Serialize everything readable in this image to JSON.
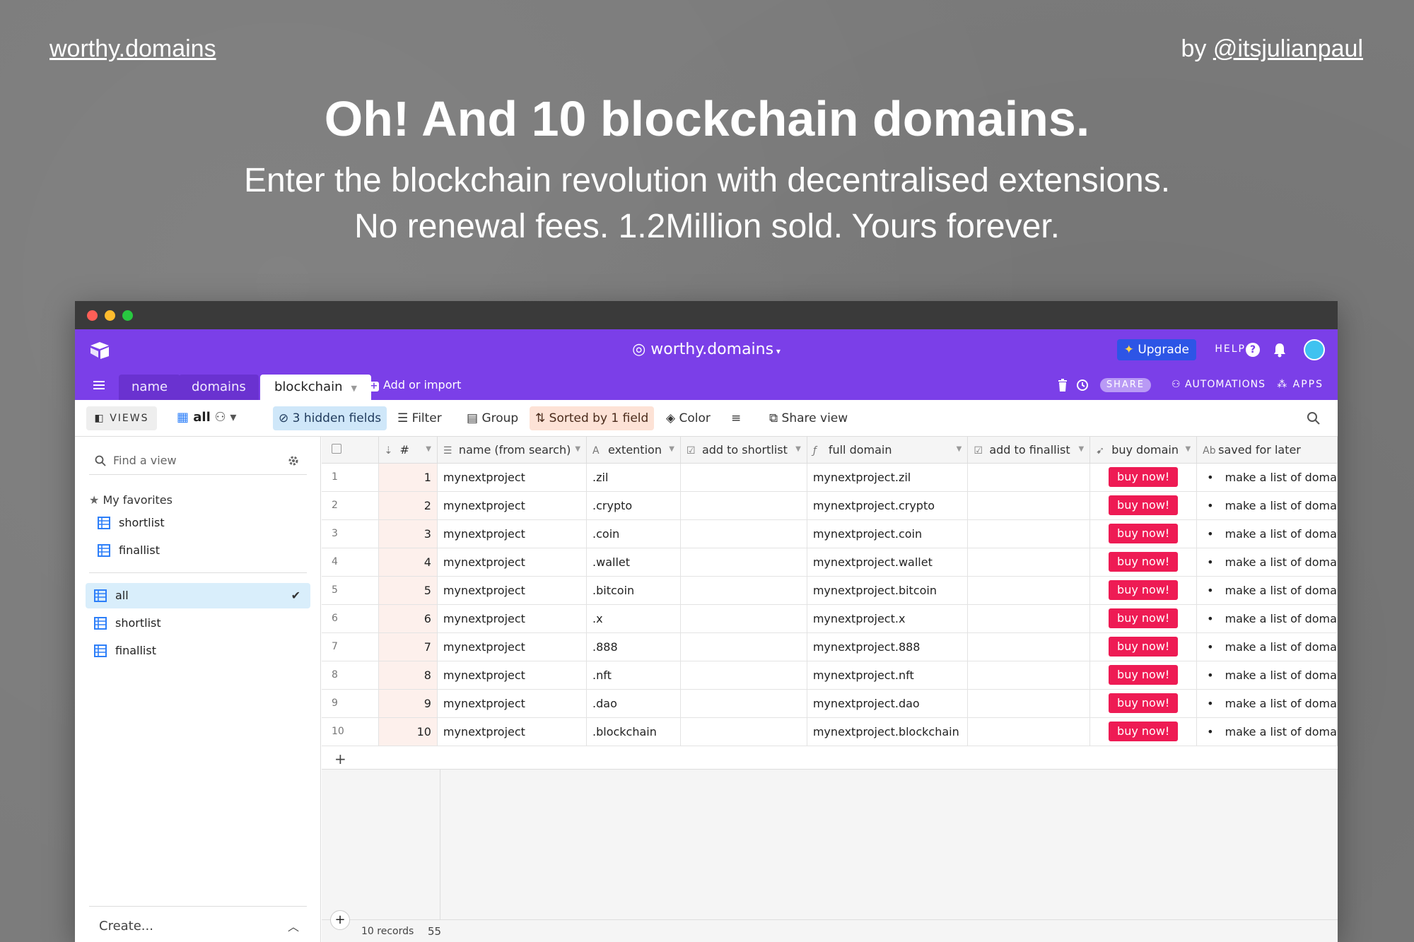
{
  "page": {
    "site_link": "worthy.domains",
    "byline_prefix": "by ",
    "byline_handle": "@itsjulianpaul",
    "headline": "Oh! And 10 blockchain domains.",
    "subline1": "Enter the blockchain revolution with decentralised extensions.",
    "subline2": "No renewal fees. 1.2Million sold. Yours forever."
  },
  "app": {
    "title": "worthy.domains",
    "upgrade": "Upgrade",
    "help": "HELP",
    "tabs": [
      "name",
      "domains",
      "blockchain"
    ],
    "add_import": "Add or import",
    "share": "SHARE",
    "automations": "AUTOMATIONS",
    "apps": "APPS",
    "accent": "#7b3fe8"
  },
  "toolbar": {
    "views": "VIEWS",
    "current_view": "all",
    "hidden_fields": "3 hidden fields",
    "filter": "Filter",
    "group": "Group",
    "sorted": "Sorted by 1 field",
    "color": "Color",
    "share_view": "Share view"
  },
  "sidebar": {
    "find_placeholder": "Find a view",
    "favorites_title": "My favorites",
    "favorites": [
      "shortlist",
      "finallist"
    ],
    "views": [
      "all",
      "shortlist",
      "finallist"
    ],
    "selected_view": "all",
    "create": "Create..."
  },
  "grid": {
    "columns": [
      "#",
      "name (from search)",
      "extention",
      "add to shortlist",
      "full domain",
      "add to finallist",
      "buy domain",
      "saved for later"
    ],
    "rows": [
      {
        "row": "1",
        "num": "1",
        "name": "mynextproject",
        "ext": ".zil",
        "full": "mynextproject.zil",
        "buy": "buy now!",
        "later": "make a list of doma"
      },
      {
        "row": "2",
        "num": "2",
        "name": "mynextproject",
        "ext": ".crypto",
        "full": "mynextproject.crypto",
        "buy": "buy now!",
        "later": "make a list of doma"
      },
      {
        "row": "3",
        "num": "3",
        "name": "mynextproject",
        "ext": ".coin",
        "full": "mynextproject.coin",
        "buy": "buy now!",
        "later": "make a list of doma"
      },
      {
        "row": "4",
        "num": "4",
        "name": "mynextproject",
        "ext": ".wallet",
        "full": "mynextproject.wallet",
        "buy": "buy now!",
        "later": "make a list of doma"
      },
      {
        "row": "5",
        "num": "5",
        "name": "mynextproject",
        "ext": ".bitcoin",
        "full": "mynextproject.bitcoin",
        "buy": "buy now!",
        "later": "make a list of doma"
      },
      {
        "row": "6",
        "num": "6",
        "name": "mynextproject",
        "ext": ".x",
        "full": "mynextproject.x",
        "buy": "buy now!",
        "later": "make a list of doma"
      },
      {
        "row": "7",
        "num": "7",
        "name": "mynextproject",
        "ext": ".888",
        "full": "mynextproject.888",
        "buy": "buy now!",
        "later": "make a list of doma"
      },
      {
        "row": "8",
        "num": "8",
        "name": "mynextproject",
        "ext": ".nft",
        "full": "mynextproject.nft",
        "buy": "buy now!",
        "later": "make a list of doma"
      },
      {
        "row": "9",
        "num": "9",
        "name": "mynextproject",
        "ext": ".dao",
        "full": "mynextproject.dao",
        "buy": "buy now!",
        "later": "make a list of doma"
      },
      {
        "row": "10",
        "num": "10",
        "name": "mynextproject",
        "ext": ".blockchain",
        "full": "mynextproject.blockchain",
        "buy": "buy now!",
        "later": "make a list of doma"
      }
    ],
    "records": "10 records",
    "sum": "55"
  }
}
